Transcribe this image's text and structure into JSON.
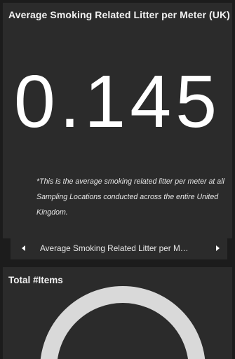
{
  "indicator": {
    "title": "Average Smoking Related Litter per Meter (UK)",
    "value": "0.145",
    "note": "*This is the average smoking related litter per meter at all Sampling Locations conducted across the entire United Kingdom."
  },
  "navigator": {
    "current_label": "Average Smoking Related Litter per M…",
    "prev_icon": "triangle-left",
    "next_icon": "triangle-right"
  },
  "total_items": {
    "title": "Total #Items"
  },
  "colors": {
    "background": "#1c1c1c",
    "card": "#2b2b2b",
    "text": "#ffffff",
    "gauge_track": "#d9d9d9"
  }
}
